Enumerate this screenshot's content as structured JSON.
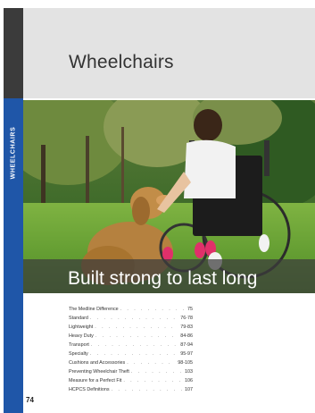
{
  "header": {
    "title": "Wheelchairs"
  },
  "side_tab": {
    "label": "WHEELCHAIRS"
  },
  "photo": {
    "caption": "Built strong to last long",
    "description_icon": "boy-in-wheelchair-with-dog-photo"
  },
  "toc": [
    {
      "label": "The Medline Difference",
      "pages": "75"
    },
    {
      "label": "Standard",
      "pages": "76-78"
    },
    {
      "label": "Lightweight",
      "pages": "79-83"
    },
    {
      "label": "Heavy Duty",
      "pages": "84-86"
    },
    {
      "label": "Transport",
      "pages": "87-94"
    },
    {
      "label": "Specialty",
      "pages": "95-97"
    },
    {
      "label": "Cushions and Accessories",
      "pages": "98-105"
    },
    {
      "label": "Preventing Wheelchair Theft",
      "pages": "103"
    },
    {
      "label": "Measure for a Perfect Fit",
      "pages": "106"
    },
    {
      "label": "HCPCS Definitions",
      "pages": "107"
    }
  ],
  "footer": {
    "page_number": "74"
  },
  "colors": {
    "tab_blue": "#1f56a8",
    "tab_dark": "#3b3b3b",
    "header_gray": "#e3e3e3"
  }
}
